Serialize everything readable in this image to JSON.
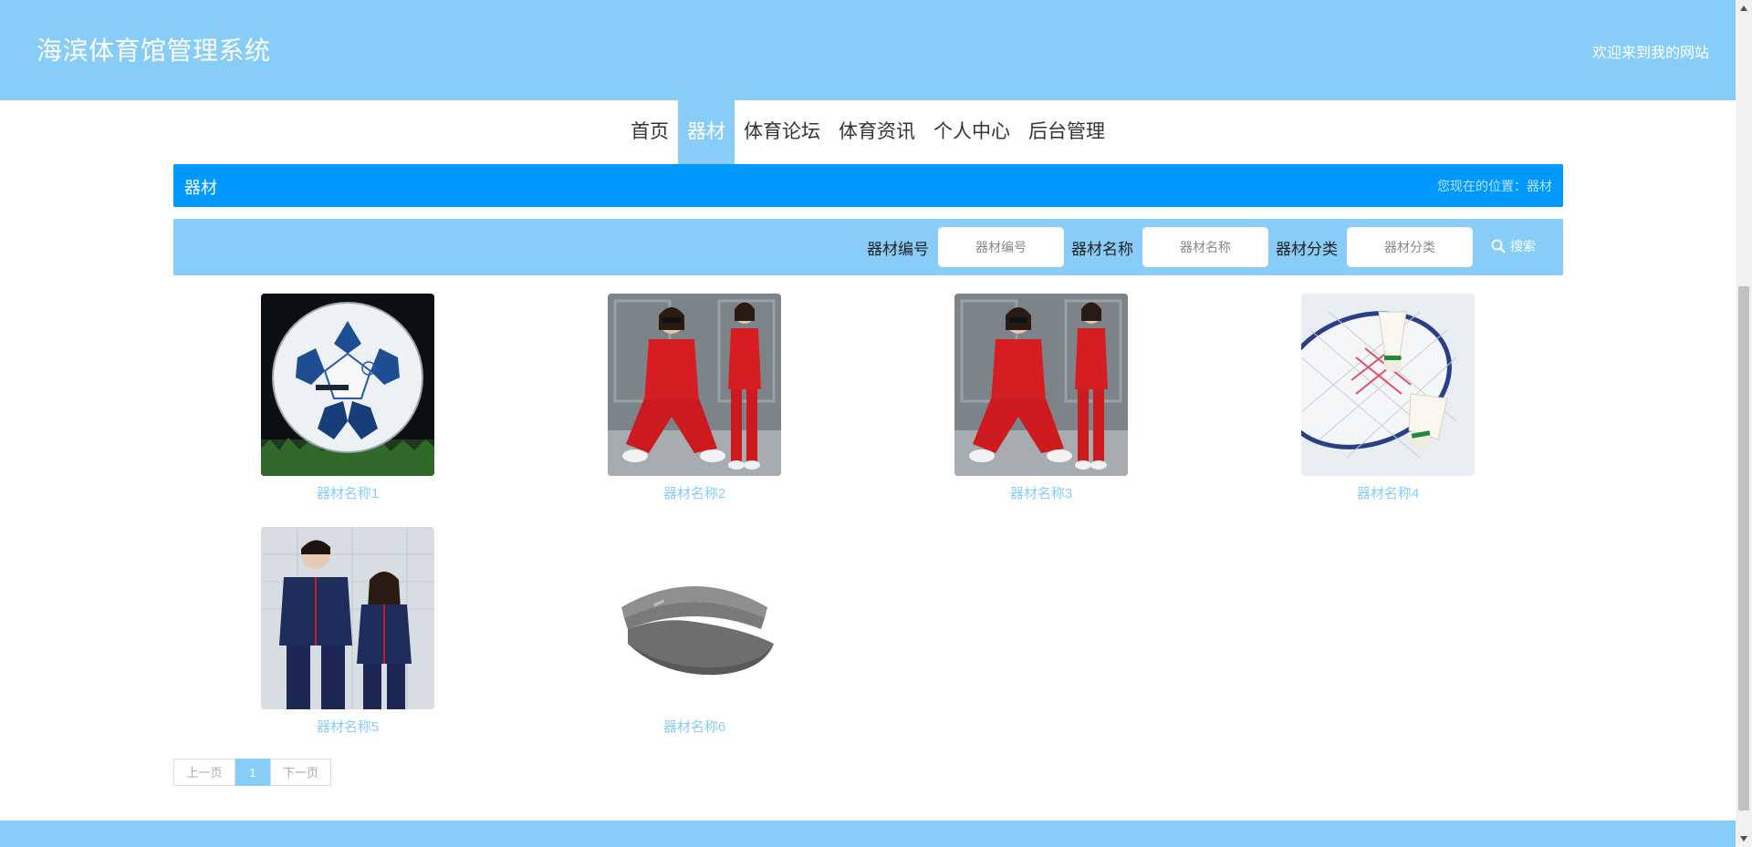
{
  "header": {
    "site_title": "海滨体育馆管理系统",
    "welcome": "欢迎来到我的网站"
  },
  "nav": {
    "items": [
      {
        "label": "首页"
      },
      {
        "label": "器材",
        "active": true
      },
      {
        "label": "体育论坛"
      },
      {
        "label": "体育资讯"
      },
      {
        "label": "个人中心"
      },
      {
        "label": "后台管理"
      }
    ]
  },
  "section": {
    "title": "器材",
    "location": "您现在的位置：器材"
  },
  "search": {
    "fields": [
      {
        "label": "器材编号",
        "placeholder": "器材编号"
      },
      {
        "label": "器材名称",
        "placeholder": "器材名称"
      },
      {
        "label": "器材分类",
        "placeholder": "器材分类"
      }
    ],
    "button_label": "搜索",
    "button_icon": "search-icon"
  },
  "items": [
    {
      "name": "器材名称1",
      "image": "soccer-ball"
    },
    {
      "name": "器材名称2",
      "image": "red-tracksuit"
    },
    {
      "name": "器材名称3",
      "image": "red-tracksuit"
    },
    {
      "name": "器材名称4",
      "image": "badminton-racket-shuttlecocks"
    },
    {
      "name": "器材名称5",
      "image": "navy-couple-tracksuits"
    },
    {
      "name": "器材名称6",
      "image": "gray-visor-cap"
    }
  ],
  "pagination": {
    "prev_label": "上一页",
    "current_page": "1",
    "next_label": "下一页"
  },
  "colors": {
    "primary_light": "#88cdf7",
    "primary": "#0099ff"
  }
}
